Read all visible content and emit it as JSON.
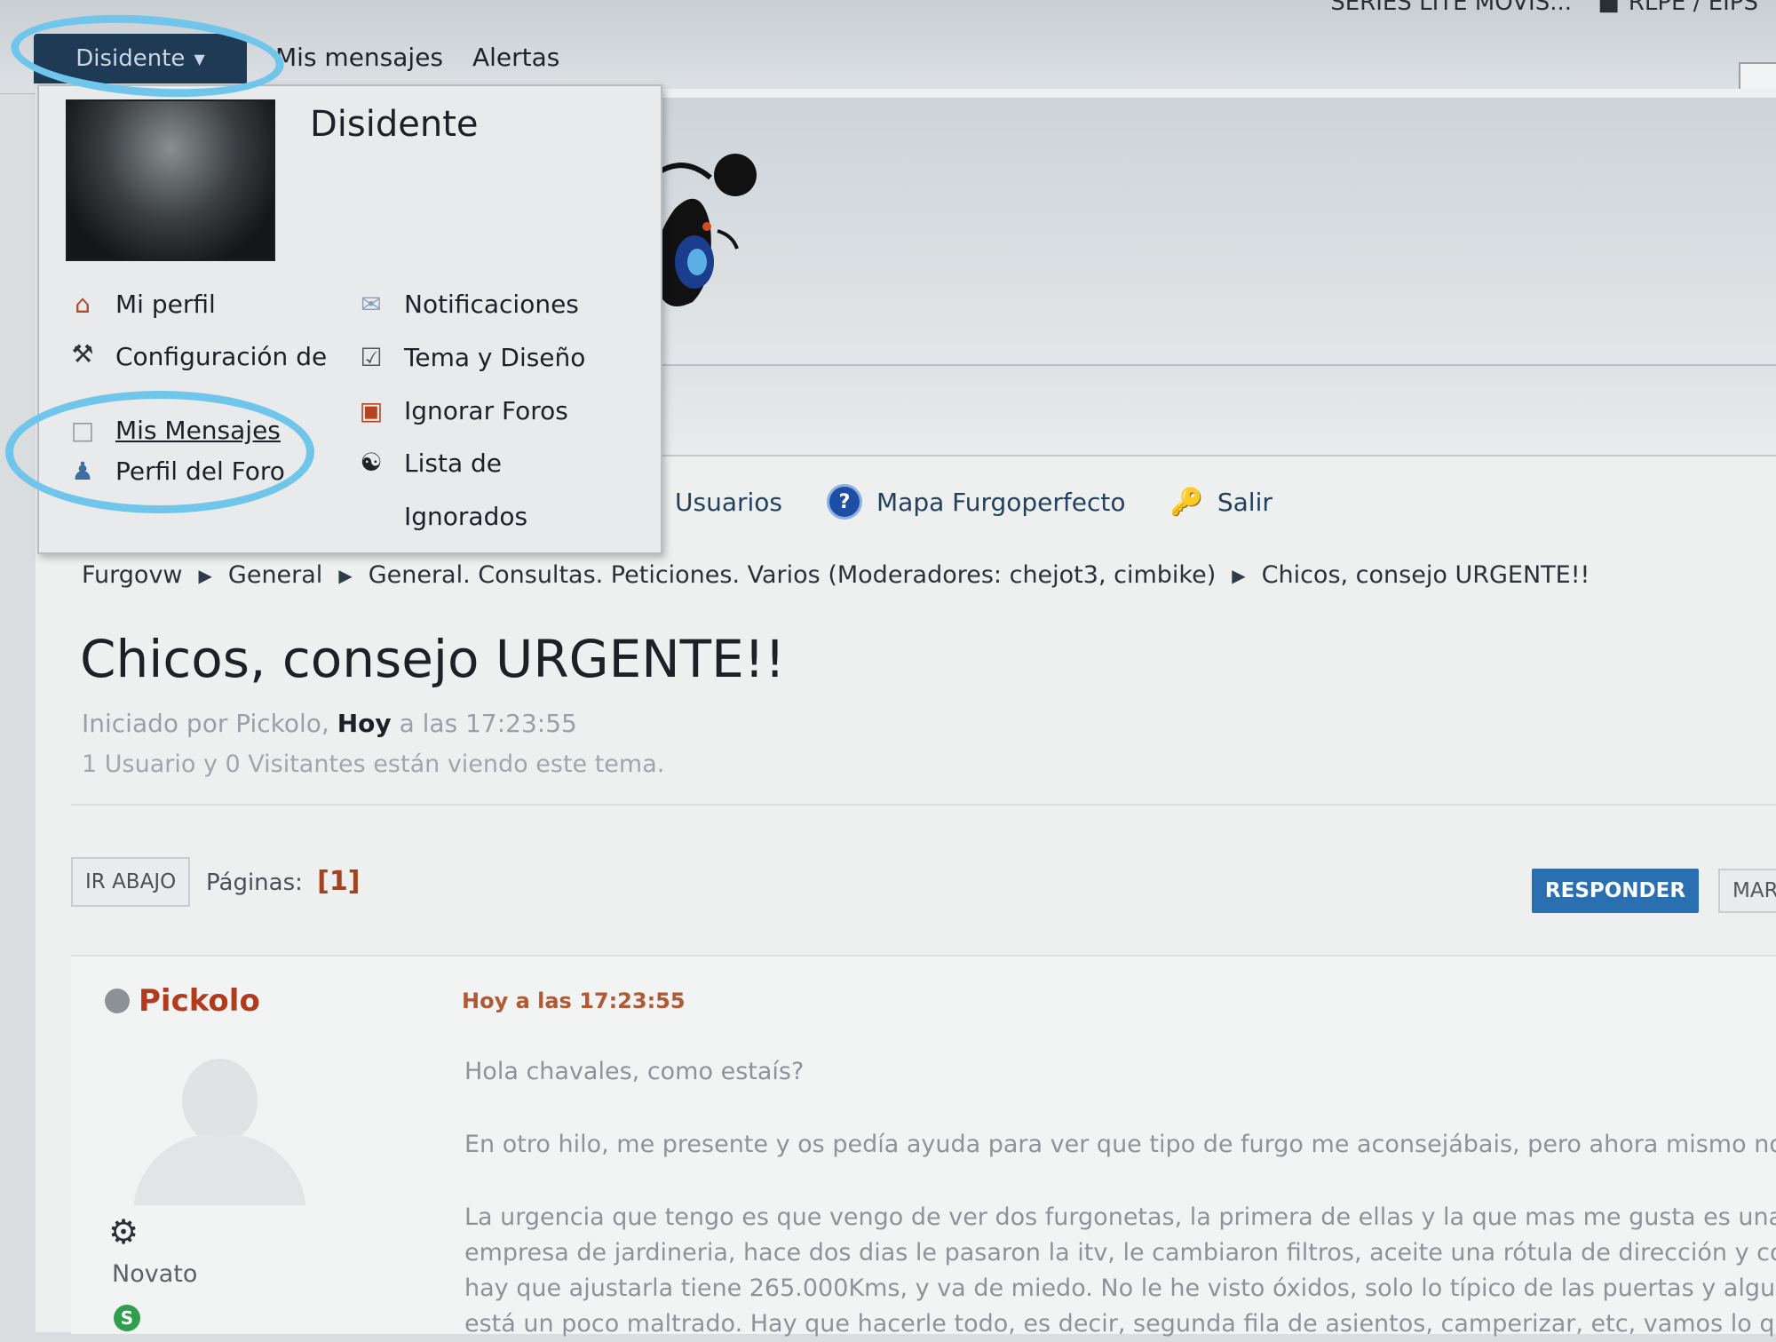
{
  "topbar": {
    "user_tab_label": "Disidente",
    "links": [
      "Mis mensajes",
      "Alertas"
    ],
    "right_text_1": "SERIES LITE   MOVIS...",
    "right_text_2": "RLPE / EIPS"
  },
  "dropdown": {
    "username": "Disidente",
    "left_items": [
      {
        "label": "Mi perfil",
        "icon": "house-icon"
      },
      {
        "label": "Configuración de Cuenta",
        "icon": "tools-icon"
      },
      {
        "label": "Mis Mensajes",
        "icon": "document-icon"
      },
      {
        "label": "Perfil del Foro",
        "icon": "user-icon"
      }
    ],
    "right_items": [
      {
        "label": "Notificaciones",
        "icon": "envelope-icon"
      },
      {
        "label": "Tema y Diseño",
        "icon": "theme-icon"
      },
      {
        "label": "Ignorar Foros",
        "icon": "ignore-forums-icon"
      },
      {
        "label": "Lista de Ignorados",
        "icon": "yin-yang-icon"
      }
    ]
  },
  "mainnav": {
    "items": [
      {
        "label": "Usuarios",
        "icon": ""
      },
      {
        "label": "Mapa Furgoperfecto",
        "icon": "help-icon"
      },
      {
        "label": "Salir",
        "icon": "key-icon"
      }
    ]
  },
  "breadcrumb": [
    "Furgovw",
    "General",
    "General. Consultas. Peticiones. Varios (Moderadores: chejot3, cimbike)",
    "Chicos, consejo URGENTE!!"
  ],
  "topic": {
    "title": "Chicos, consejo URGENTE!!",
    "started_by": "Iniciado por Pickolo,",
    "started_day": "Hoy",
    "started_time": "a las 17:23:55",
    "viewers": "1 Usuario y 0 Visitantes están viendo este tema."
  },
  "pagination": {
    "down_label": "IR ABAJO",
    "pages_label": "Páginas:",
    "current_page": "[1]",
    "reply_label": "RESPONDER",
    "mark_label": "MAR"
  },
  "post": {
    "author": "Pickolo",
    "rank": "Novato",
    "time": "Hoy a las 17:23:55",
    "paragraph_1": "Hola chavales, como estaís?",
    "paragraph_2": "En otro hilo, me presente y os pedía ayuda para ver que tipo de furgo me aconsejábais, pero ahora mismo no",
    "paragraph_3_lines": [
      "La urgencia que tengo es que vengo de ver dos furgonetas, la primera de ellas y la que mas me gusta es una T",
      "empresa de jardineria, hace dos dias le pasaron la itv, le cambiaron filtros, aceite una rótula de dirección y corr",
      "hay que ajustarla tiene 265.000Kms, y va de miedo. No le he visto óxidos, solo lo típico de las puertas y alguna",
      "está un poco maltrado. Hay que hacerle todo, es decir, segunda fila de asientos, camperizar, etc, vamos lo que"
    ]
  },
  "colors": {
    "accent": "#2a6fb0",
    "author": "#b23a1d",
    "highlight": "#6fc6ea"
  }
}
